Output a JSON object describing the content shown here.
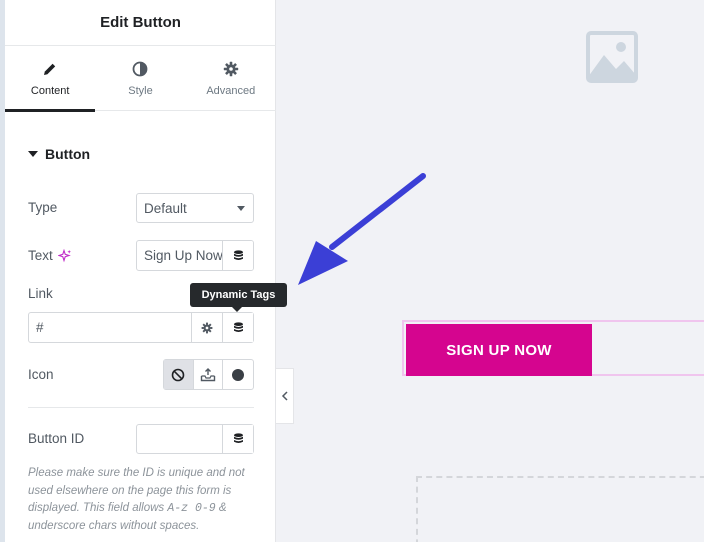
{
  "panel": {
    "title": "Edit Button",
    "tabs": [
      {
        "label": "Content",
        "icon": "pencil-icon",
        "active": true
      },
      {
        "label": "Style",
        "icon": "contrast-icon",
        "active": false
      },
      {
        "label": "Advanced",
        "icon": "gear-icon",
        "active": false
      }
    ],
    "section_title": "Button",
    "fields": {
      "type": {
        "label": "Type",
        "value": "Default"
      },
      "text": {
        "label": "Text",
        "value": "Sign Up Now"
      },
      "link": {
        "label": "Link",
        "value": "#"
      },
      "icon": {
        "label": "Icon"
      },
      "button_id": {
        "label": "Button ID",
        "value": ""
      }
    },
    "help_text_1": "Please make sure the ID is unique and not used elsewhere on the page this form is displayed. This field allows ",
    "help_code_1": "A-z 0-9",
    "help_text_2": " & underscore chars without spaces."
  },
  "tooltip": "Dynamic Tags",
  "canvas": {
    "button_label": "SIGN UP NOW"
  },
  "colors": {
    "accent_button": "#d5058f",
    "arrow": "#3b3fd6",
    "ai_sparkle": "#c02ac9"
  }
}
